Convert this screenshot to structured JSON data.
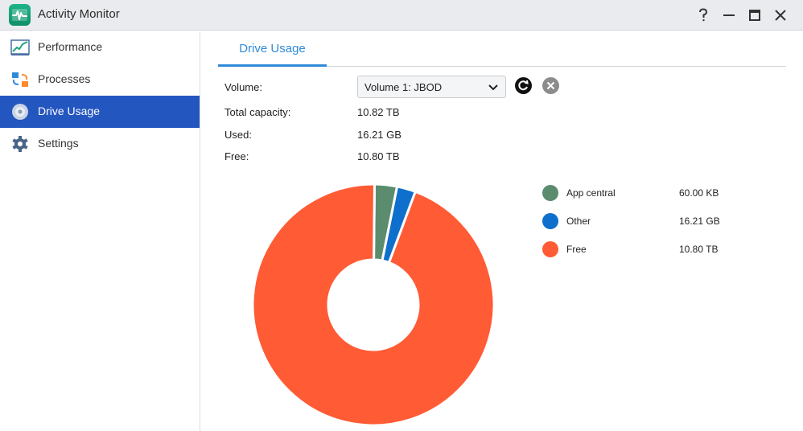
{
  "window": {
    "title": "Activity Monitor"
  },
  "sidebar": {
    "items": [
      {
        "label": "Performance",
        "icon": "performance-chart-icon"
      },
      {
        "label": "Processes",
        "icon": "processes-icon"
      },
      {
        "label": "Drive Usage",
        "icon": "drive-icon",
        "active": true
      },
      {
        "label": "Settings",
        "icon": "gear-icon"
      }
    ]
  },
  "tabs": [
    {
      "label": "Drive Usage",
      "active": true
    }
  ],
  "details": {
    "volume_label": "Volume:",
    "volume_value": "Volume 1: JBOD",
    "total_label": "Total capacity:",
    "total_value": "10.82 TB",
    "used_label": "Used:",
    "used_value": "16.21 GB",
    "free_label": "Free:",
    "free_value": "10.80 TB"
  },
  "legend": [
    {
      "name": "App central",
      "value": "60.00 KB",
      "color": "#5b8c6e"
    },
    {
      "name": "Other",
      "value": "16.21 GB",
      "color": "#0f6fcc"
    },
    {
      "name": "Free",
      "value": "10.80 TB",
      "color": "#ff5b35"
    }
  ],
  "chart_data": {
    "type": "pie",
    "categories": [
      "App central",
      "Other",
      "Free"
    ],
    "values": [
      0.03,
      0.025,
      0.945
    ],
    "colors": [
      "#5b8c6e",
      "#0f6fcc",
      "#ff5b35"
    ],
    "title": "",
    "legend_position": "right"
  }
}
